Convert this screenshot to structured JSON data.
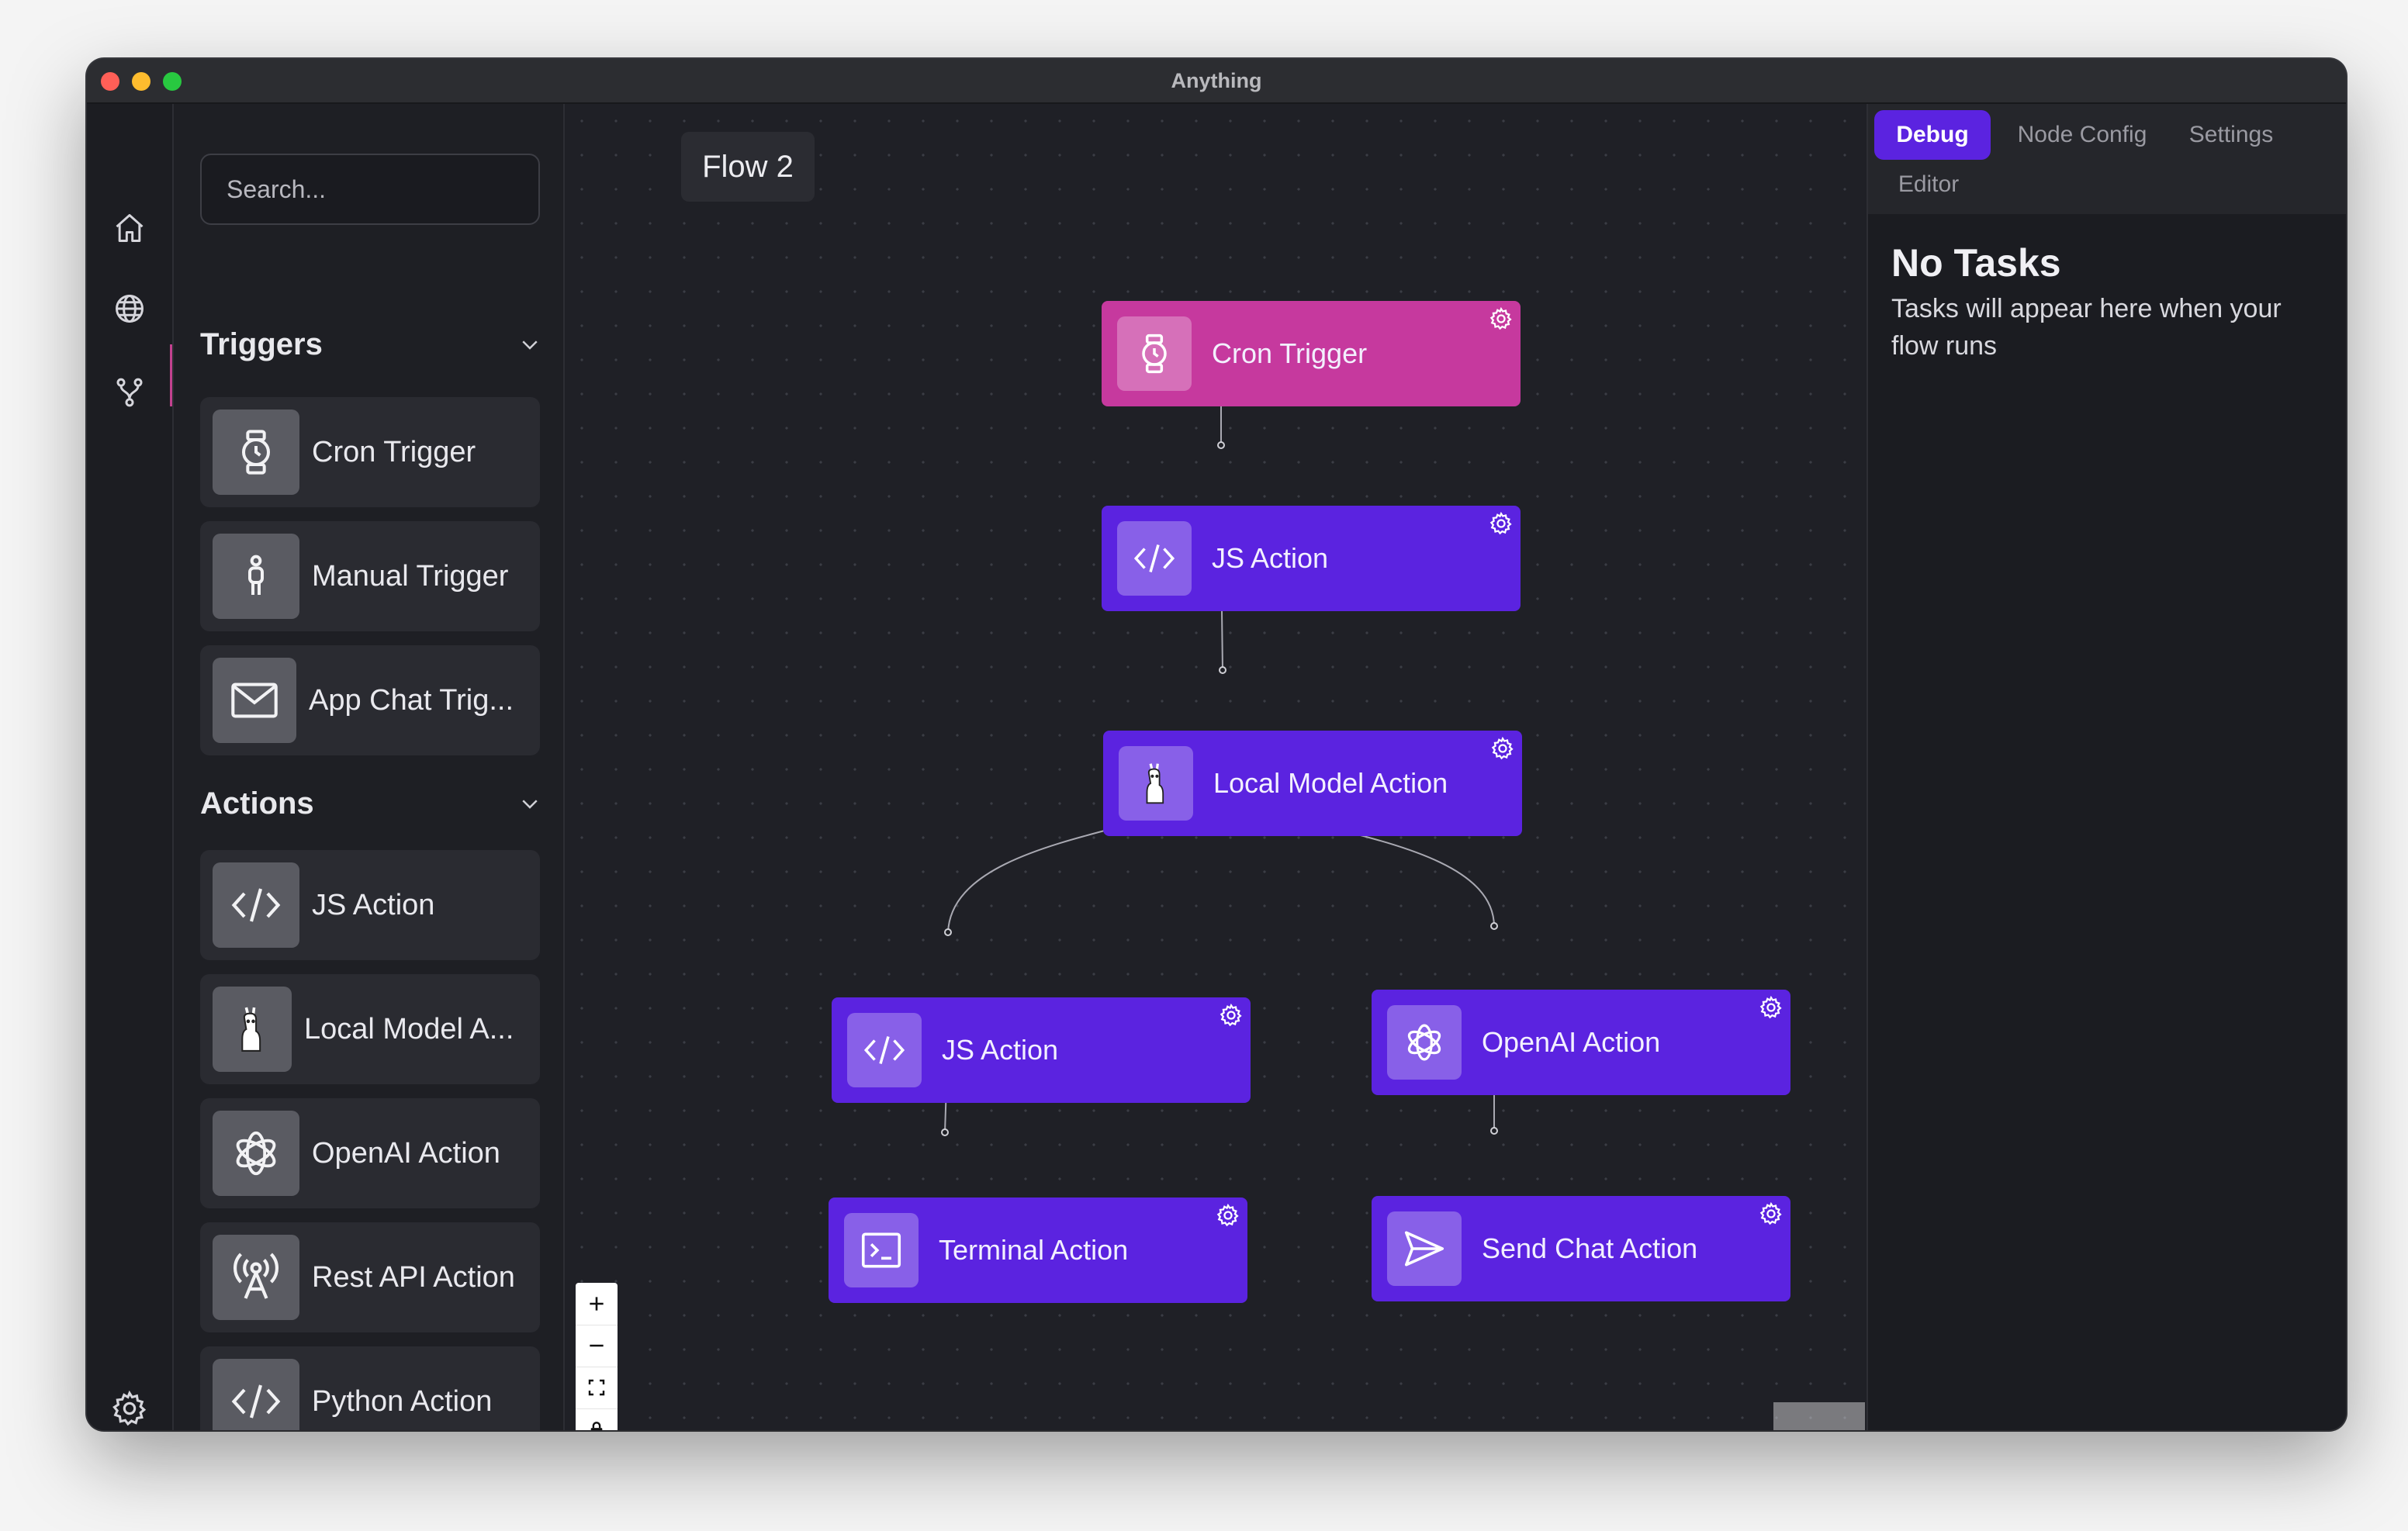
{
  "window": {
    "title": "Anything"
  },
  "rail": {
    "items": [
      {
        "icon": "home-icon"
      },
      {
        "icon": "globe-icon"
      },
      {
        "icon": "flows-icon",
        "active": true
      },
      {
        "icon": "gear-icon"
      }
    ]
  },
  "library": {
    "search_placeholder": "Search...",
    "triggers": {
      "title": "Triggers",
      "items": [
        {
          "label": "Cron Trigger",
          "icon": "watch-icon"
        },
        {
          "label": "Manual Trigger",
          "icon": "person-icon"
        },
        {
          "label": "App Chat Trig...",
          "icon": "mail-icon"
        }
      ]
    },
    "actions": {
      "title": "Actions",
      "items": [
        {
          "label": "JS Action",
          "icon": "code-icon"
        },
        {
          "label": "Local Model A...",
          "icon": "llama-icon"
        },
        {
          "label": "OpenAI Action",
          "icon": "openai-icon"
        },
        {
          "label": "Rest API Action",
          "icon": "antenna-icon"
        },
        {
          "label": "Python Action",
          "icon": "code-icon"
        }
      ]
    }
  },
  "canvas": {
    "flow_name": "Flow 2",
    "nodes": [
      {
        "label": "Cron Trigger",
        "icon": "watch-icon",
        "kind": "trigger"
      },
      {
        "label": "JS Action",
        "icon": "code-icon",
        "kind": "action"
      },
      {
        "label": "Local Model Action",
        "icon": "llama-icon",
        "kind": "action"
      },
      {
        "label": "JS Action",
        "icon": "code-icon",
        "kind": "action"
      },
      {
        "label": "OpenAI Action",
        "icon": "openai-icon",
        "kind": "action"
      },
      {
        "label": "Terminal Action",
        "icon": "terminal-icon",
        "kind": "action"
      },
      {
        "label": "Send Chat Action",
        "icon": "send-icon",
        "kind": "action"
      }
    ],
    "controls": [
      "zoom-in-icon",
      "zoom-out-icon",
      "fit-view-icon",
      "lock-icon"
    ]
  },
  "panel": {
    "tabs": [
      "Debug",
      "Node Config",
      "Settings",
      "Editor"
    ],
    "active_tab": "Debug",
    "empty_title": "No Tasks",
    "empty_description": "Tasks will appear here when your flow runs"
  },
  "colors": {
    "accent": "#5b23e0",
    "trigger": "#c6399e",
    "background": "#1f2026"
  }
}
